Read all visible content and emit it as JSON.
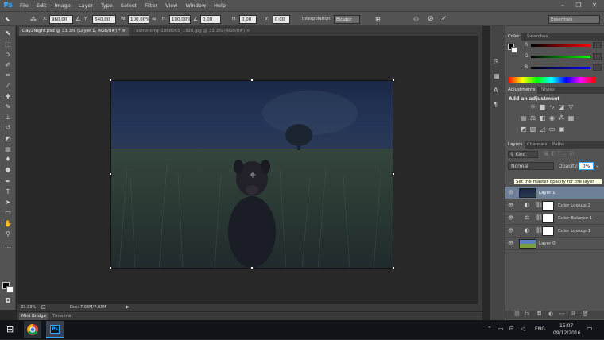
{
  "app": {
    "logo": "Ps",
    "accent": "#31a8ff"
  },
  "menu": [
    "File",
    "Edit",
    "Image",
    "Layer",
    "Type",
    "Select",
    "Filter",
    "View",
    "Window",
    "Help"
  ],
  "window_controls": [
    "–",
    "❐",
    "✕"
  ],
  "options": {
    "x_label": "X:",
    "x_value": "960.00 px",
    "y_label": "Y:",
    "y_value": "640.00 px",
    "w_label": "W:",
    "w_value": "100.00%",
    "h_label": "H:",
    "h_value": "100.00%",
    "angle_value": "0.00",
    "hskew_label": "H:",
    "hskew_value": "0.00",
    "vskew_label": "V:",
    "vskew_value": "0.00",
    "interp_label": "Interpolation:",
    "interp_value": "Bicubic",
    "workspace": "Essentials"
  },
  "tabs": [
    {
      "label": "Day2Night.psd @ 33.3% (Layer 1, RGB/8#) *",
      "close": "×"
    },
    {
      "label": "astronomy-1868065_1920.jpg @ 33.3% (RGB/8#)",
      "close": "×"
    }
  ],
  "status": {
    "zoom": "33.33%",
    "doc": "Doc: 7.03M/7.03M"
  },
  "bottom_tabs": [
    "Mini Bridge",
    "Timeline"
  ],
  "color_panel": {
    "tabs": [
      "Color",
      "Swatches"
    ],
    "channels": [
      "R",
      "G",
      "B"
    ]
  },
  "adjustments_panel": {
    "tabs": [
      "Adjustments",
      "Styles"
    ],
    "heading": "Add an adjustment"
  },
  "layers_panel": {
    "tabs": [
      "Layers",
      "Channels",
      "Paths"
    ],
    "kind_label": "Kind",
    "blend_mode": "Normal",
    "opacity_label": "Opacity:",
    "opacity_value": "0%",
    "tooltip": "Set the master opacity for the layer",
    "layers": [
      {
        "name": "Layer 1",
        "selected": true
      },
      {
        "name": "Color Lookup 2",
        "selected": false
      },
      {
        "name": "Color Balance 1",
        "selected": false
      },
      {
        "name": "Color Lookup 1",
        "selected": false
      },
      {
        "name": "Layer 0",
        "selected": false
      }
    ]
  },
  "taskbar": {
    "lang": "ENG",
    "time": "15:07",
    "date": "09/12/2016"
  }
}
